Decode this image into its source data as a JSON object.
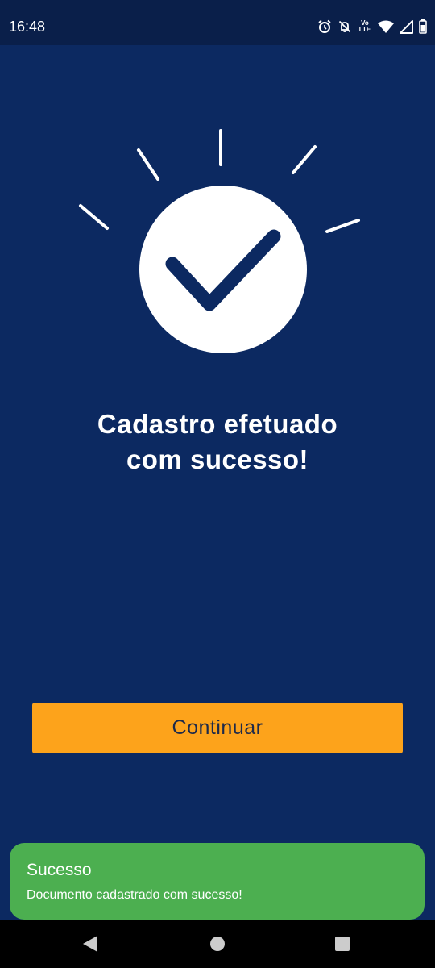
{
  "status_bar": {
    "time": "16:48",
    "volte_label_top": "Vo",
    "volte_label_bottom": "LTE",
    "icons": [
      "alarm-icon",
      "notifications-off-icon",
      "volte-icon",
      "wifi-icon",
      "signal-icon",
      "battery-icon"
    ]
  },
  "main": {
    "title_line1": "Cadastro efetuado",
    "title_line2": "com sucesso!",
    "illustration_icon": "check-circle-icon",
    "continue_label": "Continuar"
  },
  "toast": {
    "title": "Sucesso",
    "message": "Documento cadastrado com sucesso!"
  },
  "nav_bar": {
    "icons": [
      "back-icon",
      "home-icon",
      "recents-icon"
    ]
  },
  "colors": {
    "background": "#0c2961",
    "status_bar": "#0a1f4a",
    "button": "#fda31b",
    "toast": "#4caf50",
    "nav_bar": "#000000"
  }
}
